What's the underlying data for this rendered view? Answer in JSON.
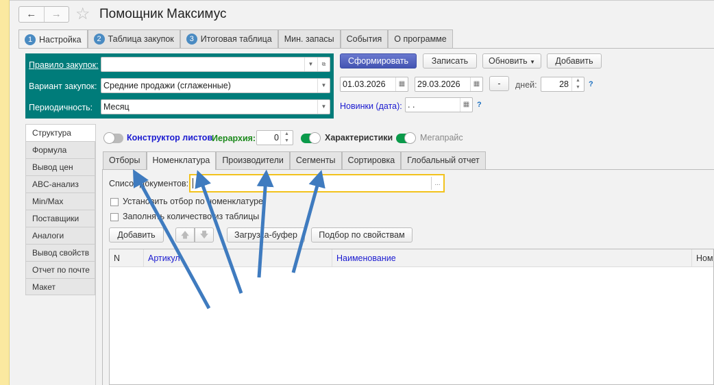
{
  "window": {
    "title": "Помощник Максимус",
    "back": "←",
    "forward": "→",
    "star": "☆"
  },
  "main_tabs": [
    {
      "num": "1",
      "label": "Настройка"
    },
    {
      "num": "2",
      "label": "Таблица закупок"
    },
    {
      "num": "3",
      "label": "Итоговая таблица"
    },
    {
      "label": "Мин. запасы"
    },
    {
      "label": "События"
    },
    {
      "label": "О программе"
    }
  ],
  "params": {
    "rule_label": "Правило закупок:",
    "rule_value": "",
    "variant_label": "Вариант закупок:",
    "variant_value": "Средние продажи (сглаженные)",
    "period_label": "Периодичность:",
    "period_value": "Месяц"
  },
  "toolbar": {
    "generate": "Сформировать",
    "save": "Записать",
    "refresh": "Обновить",
    "add": "Добавить"
  },
  "dates": {
    "from": "01.03.2026",
    "to": "29.03.2026",
    "minus": "-",
    "days_label": "дней:",
    "days": "28",
    "help": "?",
    "new_label": "Новинки (дата):",
    "new_value": " .  .",
    "help2": "?"
  },
  "side_tabs": [
    "Структура",
    "Формула",
    "Вывод цен",
    "ABC-анализ",
    "Min/Max",
    "Поставщики",
    "Аналоги",
    "Вывод свойств",
    "Отчет по почте",
    "Макет"
  ],
  "options": {
    "constructor": "Конструктор листов",
    "hierarchy_label": "Иерархия:",
    "hierarchy": "0",
    "characteristics": "Характеристики",
    "megaprice": "Мегапрайс"
  },
  "sub_tabs": [
    "Отборы",
    "Номенклатура",
    "Производители",
    "Сегменты",
    "Сортировка",
    "Глобальный отчет"
  ],
  "nomen": {
    "doc_list_label": "Список документов:",
    "doc_list_value": "",
    "dots": "...",
    "chk1": "Установить отбор по номенклатуре",
    "chk2": "Заполнять количество из таблицы",
    "add": "Добавить",
    "up": "🡅",
    "down": "🡇",
    "buffer": "Загрузка-буфер",
    "by_props": "Подбор по свойствам"
  },
  "table": {
    "columns": [
      "N",
      "Артикул",
      "Наименование",
      "Ном"
    ]
  },
  "colors": {
    "teal": "#007c7a",
    "arrow": "#3f7bbf",
    "accent": "#4354b2"
  }
}
